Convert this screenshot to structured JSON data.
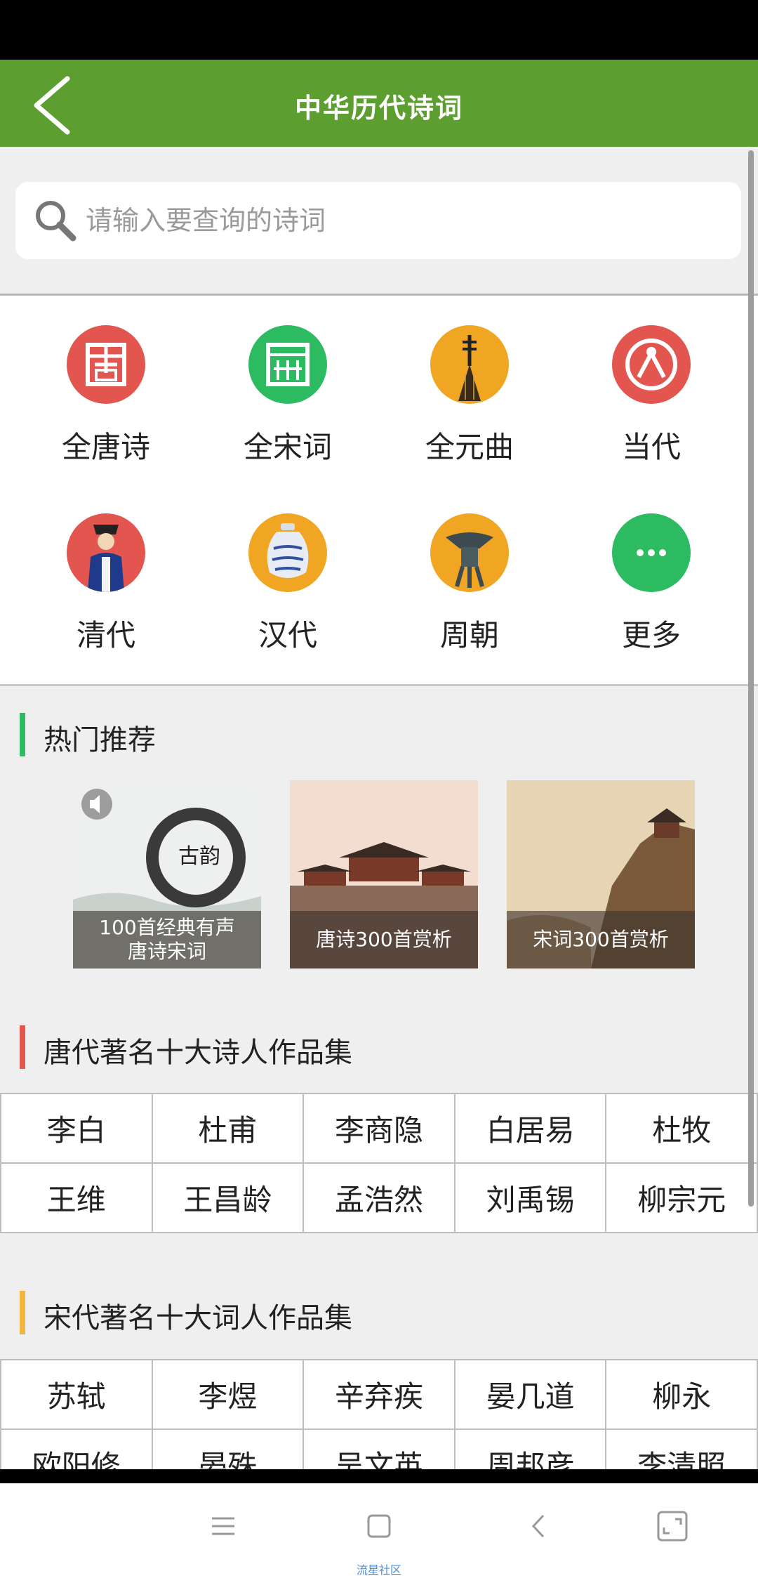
{
  "header": {
    "title": "中华历代诗词"
  },
  "search": {
    "placeholder": "请输入要查询的诗词"
  },
  "categories": [
    {
      "label": "全唐诗",
      "icon": "tang-seal-icon",
      "color": "#e2564f"
    },
    {
      "label": "全宋词",
      "icon": "song-seal-icon",
      "color": "#2dbb62"
    },
    {
      "label": "全元曲",
      "icon": "pipa-instrument-icon",
      "color": "#f0a623"
    },
    {
      "label": "当代",
      "icon": "modern-emblem-icon",
      "color": "#e2564f"
    },
    {
      "label": "清代",
      "icon": "qing-official-icon",
      "color": "#e2564f"
    },
    {
      "label": "汉代",
      "icon": "porcelain-jar-icon",
      "color": "#f0a623"
    },
    {
      "label": "周朝",
      "icon": "bronze-vessel-icon",
      "color": "#f0a623"
    },
    {
      "label": "更多",
      "icon": "more-dots-icon",
      "color": "#2dbb62"
    }
  ],
  "hot": {
    "title": "热门推荐",
    "bar_color": "#2dbb62",
    "cards": [
      {
        "caption": "100首经典有声\n唐诗宋词"
      },
      {
        "caption": "唐诗300首赏析"
      },
      {
        "caption": "宋词300首赏析"
      }
    ]
  },
  "tang": {
    "title": "唐代著名十大诗人作品集",
    "bar_color": "#e2564f",
    "poets": [
      "李白",
      "杜甫",
      "李商隐",
      "白居易",
      "杜牧",
      "王维",
      "王昌龄",
      "孟浩然",
      "刘禹锡",
      "柳宗元"
    ]
  },
  "song": {
    "title": "宋代著名十大词人作品集",
    "bar_color": "#f0b640",
    "poets": [
      "苏轼",
      "李煜",
      "辛弃疾",
      "晏几道",
      "柳永",
      "欧阳修",
      "晏殊",
      "吴文英",
      "周邦彦",
      "李清照"
    ]
  },
  "navbar": {
    "watermark": "流星社区"
  }
}
